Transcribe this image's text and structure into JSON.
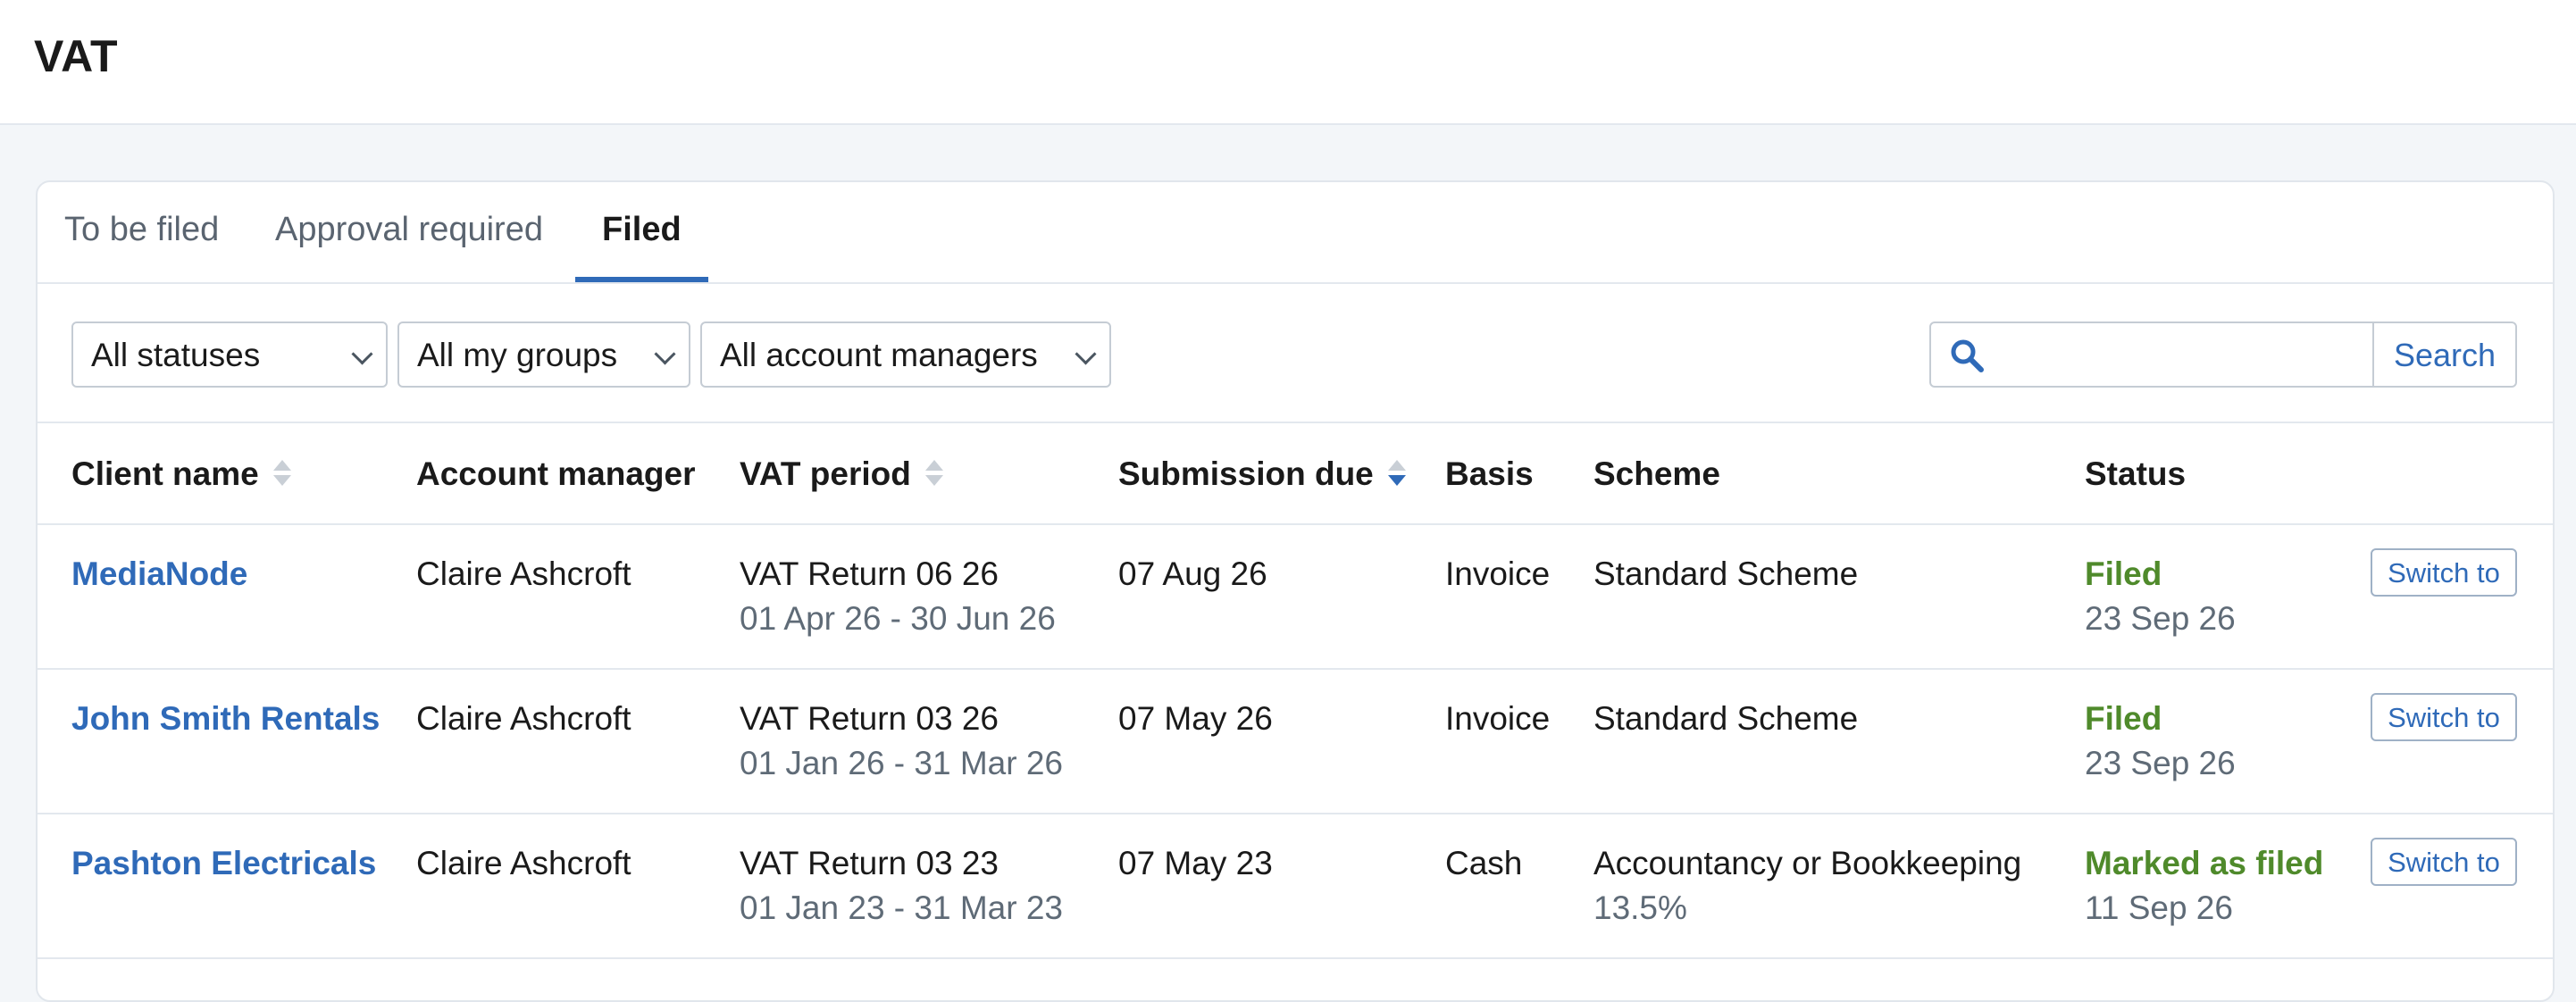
{
  "page": {
    "title": "VAT"
  },
  "tabs": [
    {
      "label": "To be filed",
      "active": false
    },
    {
      "label": "Approval required",
      "active": false
    },
    {
      "label": "Filed",
      "active": true
    }
  ],
  "filters": {
    "status": "All statuses",
    "groups": "All my groups",
    "managers": "All account managers",
    "search_placeholder": "",
    "search_label": "Search"
  },
  "table": {
    "columns": [
      "Client name",
      "Account manager",
      "VAT period",
      "Submission due",
      "Basis",
      "Scheme",
      "Status"
    ],
    "rows": [
      {
        "client": "MediaNode",
        "manager": "Claire Ashcroft",
        "period": "VAT Return 06 26",
        "period_range": "01 Apr 26 - 30 Jun 26",
        "due": "07 Aug 26",
        "basis": "Invoice",
        "scheme": "Standard Scheme",
        "scheme_rate": "",
        "status": "Filed",
        "status_date": "23 Sep 26",
        "action": "Switch to"
      },
      {
        "client": "John Smith Rentals",
        "manager": "Claire Ashcroft",
        "period": "VAT Return 03 26",
        "period_range": "01 Jan 26 - 31 Mar 26",
        "due": "07 May 26",
        "basis": "Invoice",
        "scheme": "Standard Scheme",
        "scheme_rate": "",
        "status": "Filed",
        "status_date": "23 Sep 26",
        "action": "Switch to"
      },
      {
        "client": "Pashton Electricals",
        "manager": "Claire Ashcroft",
        "period": "VAT Return 03 23",
        "period_range": "01 Jan 23 - 31 Mar 23",
        "due": "07 May 23",
        "basis": "Cash",
        "scheme": "Accountancy or Bookkeeping",
        "scheme_rate": "13.5%",
        "status": "Marked as filed",
        "status_date": "11 Sep 26",
        "action": "Switch to"
      }
    ]
  },
  "colors": {
    "accent": "#2f6ab8",
    "status_ok": "#4f8a2b"
  },
  "icons": {
    "search": "search-icon",
    "sort": "sort-icon",
    "dropdown": "chevron-down-icon"
  }
}
